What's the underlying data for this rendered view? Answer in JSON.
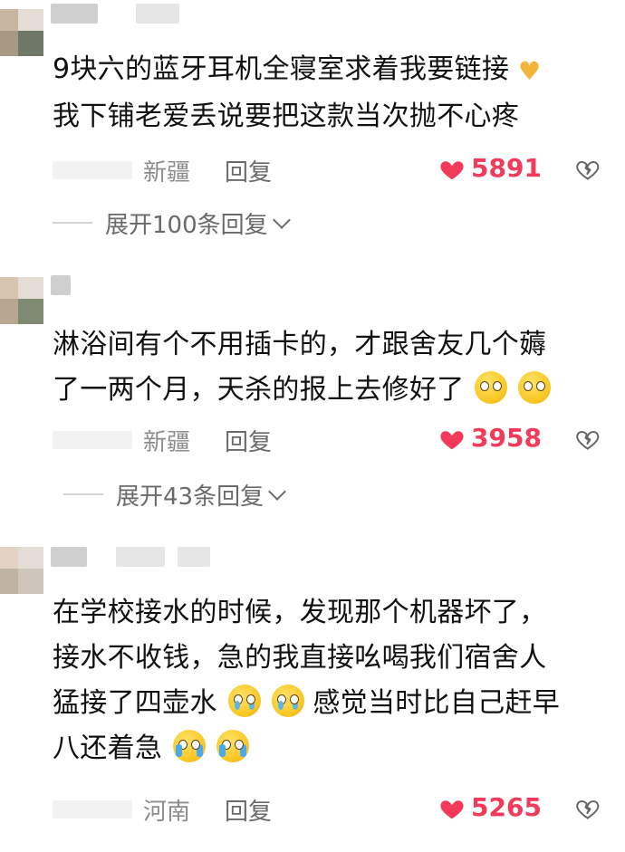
{
  "comments": [
    {
      "lines": [
        "9块六的蓝牙耳机全寝室求着我要链接",
        "我下铺老爱丢说要把这款当次抛不心疼"
      ],
      "line_emojis": [
        [
          "finger-heart"
        ],
        []
      ],
      "location": "新疆",
      "reply_label": "回复",
      "likes": "5891",
      "expand_label": "展开100条回复"
    },
    {
      "lines": [
        "淋浴间有个不用插卡的，才跟舍友几个薅",
        "了一两个月，天杀的报上去修好了"
      ],
      "line_emojis": [
        [],
        [
          "smiley",
          "smiley"
        ]
      ],
      "location": "新疆",
      "reply_label": "回复",
      "likes": "3958",
      "expand_label": "展开43条回复"
    },
    {
      "lines": [
        "在学校接水的时候，发现那个机器坏了，",
        "接水不收钱，急的我直接吆喝我们宿舍人",
        "猛接了四壶水",
        "八还着急"
      ],
      "line3_tail": "感觉当时比自己赶早",
      "line_emojis": [
        [],
        [],
        [
          "teary",
          "teary"
        ],
        [
          "crying",
          "crying"
        ]
      ],
      "location": "河南",
      "reply_label": "回复",
      "likes": "5265"
    }
  ],
  "colors": {
    "like": "#f23a5a",
    "meta_text": "#8c8c8c",
    "body_text": "#111111"
  },
  "icons": [
    "heart-icon",
    "broken-heart-icon",
    "chevron-down-icon",
    "finger-heart-emoji",
    "smiley-emoji",
    "teary-emoji",
    "crying-emoji"
  ]
}
